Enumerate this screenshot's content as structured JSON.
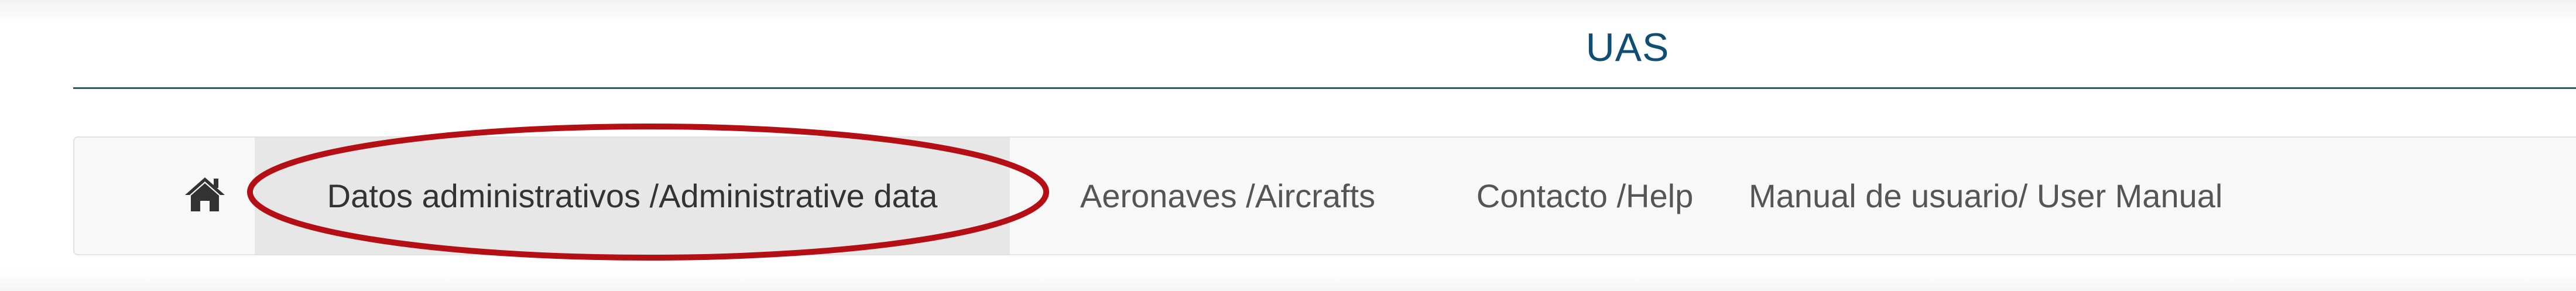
{
  "header": {
    "title": "UAS"
  },
  "nav": {
    "home_icon": "home-icon",
    "items": [
      {
        "label": "Datos administrativos /Administrative data",
        "active": true
      },
      {
        "label": "Aeronaves /Aircrafts",
        "active": false
      },
      {
        "label": "Contacto /Help",
        "active": false
      },
      {
        "label": "Manual de usuario/ User Manual",
        "active": false
      }
    ]
  },
  "annotation": {
    "highlight_color": "#b40f14",
    "highlighted_item": "Datos administrativos /Administrative data"
  },
  "colors": {
    "title": "#0e4d74",
    "rule": "#1d5e7a",
    "nav_text": "#555555",
    "nav_active_bg": "#e7e7e7"
  }
}
